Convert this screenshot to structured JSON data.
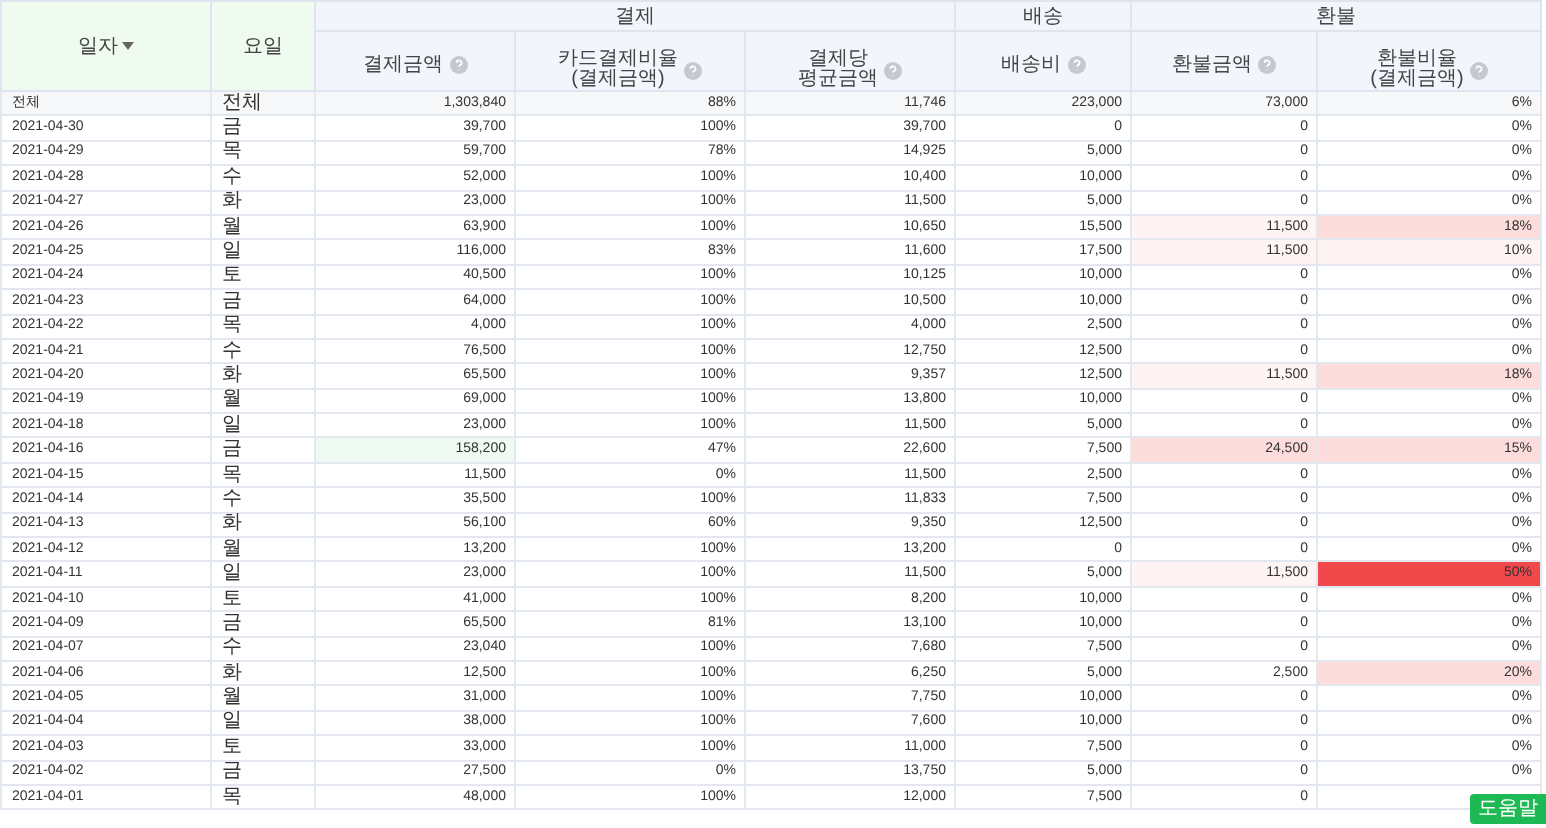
{
  "header": {
    "date": "일자",
    "weekday": "요일",
    "groups": [
      {
        "label": "결제"
      },
      {
        "label": "배송"
      },
      {
        "label": "환불"
      }
    ],
    "columns": [
      {
        "label": "결제금액"
      },
      {
        "label": "카드결제비율",
        "sub": "(결제금액)"
      },
      {
        "label": "결제당",
        "sub": "평균금액"
      },
      {
        "label": "배송비"
      },
      {
        "label": "환불금액"
      },
      {
        "label": "환불비율",
        "sub": "(결제금액)"
      }
    ]
  },
  "total": {
    "date": "전체",
    "day": "전체",
    "cells": [
      {
        "v": "1,303,840"
      },
      {
        "v": "88%"
      },
      {
        "v": "11,746"
      },
      {
        "v": "223,000"
      },
      {
        "v": "73,000"
      },
      {
        "v": "6%"
      }
    ]
  },
  "rows": [
    {
      "date": "2021-04-30",
      "day": "금",
      "cells": [
        {
          "v": "39,700"
        },
        {
          "v": "100%"
        },
        {
          "v": "39,700"
        },
        {
          "v": "0"
        },
        {
          "v": "0"
        },
        {
          "v": "0%"
        }
      ]
    },
    {
      "date": "2021-04-29",
      "day": "목",
      "cells": [
        {
          "v": "59,700"
        },
        {
          "v": "78%"
        },
        {
          "v": "14,925"
        },
        {
          "v": "5,000"
        },
        {
          "v": "0"
        },
        {
          "v": "0%"
        }
      ]
    },
    {
      "date": "2021-04-28",
      "day": "수",
      "cells": [
        {
          "v": "52,000"
        },
        {
          "v": "100%"
        },
        {
          "v": "10,400"
        },
        {
          "v": "10,000"
        },
        {
          "v": "0"
        },
        {
          "v": "0%"
        }
      ]
    },
    {
      "date": "2021-04-27",
      "day": "화",
      "cells": [
        {
          "v": "23,000"
        },
        {
          "v": "100%"
        },
        {
          "v": "11,500"
        },
        {
          "v": "5,000"
        },
        {
          "v": "0"
        },
        {
          "v": "0%"
        }
      ]
    },
    {
      "date": "2021-04-26",
      "day": "월",
      "cells": [
        {
          "v": "63,900"
        },
        {
          "v": "100%"
        },
        {
          "v": "10,650"
        },
        {
          "v": "15,500"
        },
        {
          "v": "11,500",
          "color": "#fff4f4"
        },
        {
          "v": "18%",
          "color": "#fddcdc"
        }
      ]
    },
    {
      "date": "2021-04-25",
      "day": "일",
      "cells": [
        {
          "v": "116,000"
        },
        {
          "v": "83%"
        },
        {
          "v": "11,600"
        },
        {
          "v": "17,500"
        },
        {
          "v": "11,500",
          "color": "#fff4f4"
        },
        {
          "v": "10%",
          "color": "#fff4f4"
        }
      ]
    },
    {
      "date": "2021-04-24",
      "day": "토",
      "cells": [
        {
          "v": "40,500"
        },
        {
          "v": "100%"
        },
        {
          "v": "10,125"
        },
        {
          "v": "10,000"
        },
        {
          "v": "0"
        },
        {
          "v": "0%"
        }
      ]
    },
    {
      "date": "2021-04-23",
      "day": "금",
      "cells": [
        {
          "v": "64,000"
        },
        {
          "v": "100%"
        },
        {
          "v": "10,500"
        },
        {
          "v": "10,000"
        },
        {
          "v": "0"
        },
        {
          "v": "0%"
        }
      ]
    },
    {
      "date": "2021-04-22",
      "day": "목",
      "cells": [
        {
          "v": "4,000"
        },
        {
          "v": "100%"
        },
        {
          "v": "4,000"
        },
        {
          "v": "2,500"
        },
        {
          "v": "0"
        },
        {
          "v": "0%"
        }
      ]
    },
    {
      "date": "2021-04-21",
      "day": "수",
      "cells": [
        {
          "v": "76,500"
        },
        {
          "v": "100%"
        },
        {
          "v": "12,750"
        },
        {
          "v": "12,500"
        },
        {
          "v": "0"
        },
        {
          "v": "0%"
        }
      ]
    },
    {
      "date": "2021-04-20",
      "day": "화",
      "cells": [
        {
          "v": "65,500"
        },
        {
          "v": "100%"
        },
        {
          "v": "9,357"
        },
        {
          "v": "12,500"
        },
        {
          "v": "11,500",
          "color": "#fff4f4"
        },
        {
          "v": "18%",
          "color": "#fddcdc"
        }
      ]
    },
    {
      "date": "2021-04-19",
      "day": "월",
      "cells": [
        {
          "v": "69,000"
        },
        {
          "v": "100%"
        },
        {
          "v": "13,800"
        },
        {
          "v": "10,000"
        },
        {
          "v": "0"
        },
        {
          "v": "0%"
        }
      ]
    },
    {
      "date": "2021-04-18",
      "day": "일",
      "cells": [
        {
          "v": "23,000"
        },
        {
          "v": "100%"
        },
        {
          "v": "11,500"
        },
        {
          "v": "5,000"
        },
        {
          "v": "0"
        },
        {
          "v": "0%"
        }
      ]
    },
    {
      "date": "2021-04-16",
      "day": "금",
      "cells": [
        {
          "v": "158,200",
          "color": "#effaf3"
        },
        {
          "v": "47%"
        },
        {
          "v": "22,600"
        },
        {
          "v": "7,500"
        },
        {
          "v": "24,500",
          "color": "#fddcdc"
        },
        {
          "v": "15%",
          "color": "#fddcdc"
        }
      ]
    },
    {
      "date": "2021-04-15",
      "day": "목",
      "cells": [
        {
          "v": "11,500"
        },
        {
          "v": "0%"
        },
        {
          "v": "11,500"
        },
        {
          "v": "2,500"
        },
        {
          "v": "0"
        },
        {
          "v": "0%"
        }
      ]
    },
    {
      "date": "2021-04-14",
      "day": "수",
      "cells": [
        {
          "v": "35,500"
        },
        {
          "v": "100%"
        },
        {
          "v": "11,833"
        },
        {
          "v": "7,500"
        },
        {
          "v": "0"
        },
        {
          "v": "0%"
        }
      ]
    },
    {
      "date": "2021-04-13",
      "day": "화",
      "cells": [
        {
          "v": "56,100"
        },
        {
          "v": "60%"
        },
        {
          "v": "9,350"
        },
        {
          "v": "12,500"
        },
        {
          "v": "0"
        },
        {
          "v": "0%"
        }
      ]
    },
    {
      "date": "2021-04-12",
      "day": "월",
      "cells": [
        {
          "v": "13,200"
        },
        {
          "v": "100%"
        },
        {
          "v": "13,200"
        },
        {
          "v": "0"
        },
        {
          "v": "0"
        },
        {
          "v": "0%"
        }
      ]
    },
    {
      "date": "2021-04-11",
      "day": "일",
      "cells": [
        {
          "v": "23,000"
        },
        {
          "v": "100%"
        },
        {
          "v": "11,500"
        },
        {
          "v": "5,000"
        },
        {
          "v": "11,500",
          "color": "#fff4f4"
        },
        {
          "v": "50%",
          "color": "#f0484b"
        }
      ]
    },
    {
      "date": "2021-04-10",
      "day": "토",
      "cells": [
        {
          "v": "41,000"
        },
        {
          "v": "100%"
        },
        {
          "v": "8,200"
        },
        {
          "v": "10,000"
        },
        {
          "v": "0"
        },
        {
          "v": "0%"
        }
      ]
    },
    {
      "date": "2021-04-09",
      "day": "금",
      "cells": [
        {
          "v": "65,500"
        },
        {
          "v": "81%"
        },
        {
          "v": "13,100"
        },
        {
          "v": "10,000"
        },
        {
          "v": "0"
        },
        {
          "v": "0%"
        }
      ]
    },
    {
      "date": "2021-04-07",
      "day": "수",
      "cells": [
        {
          "v": "23,040"
        },
        {
          "v": "100%"
        },
        {
          "v": "7,680"
        },
        {
          "v": "7,500"
        },
        {
          "v": "0"
        },
        {
          "v": "0%"
        }
      ]
    },
    {
      "date": "2021-04-06",
      "day": "화",
      "cells": [
        {
          "v": "12,500"
        },
        {
          "v": "100%"
        },
        {
          "v": "6,250"
        },
        {
          "v": "5,000"
        },
        {
          "v": "2,500"
        },
        {
          "v": "20%",
          "color": "#fddcdc"
        }
      ]
    },
    {
      "date": "2021-04-05",
      "day": "월",
      "cells": [
        {
          "v": "31,000"
        },
        {
          "v": "100%"
        },
        {
          "v": "7,750"
        },
        {
          "v": "10,000"
        },
        {
          "v": "0"
        },
        {
          "v": "0%"
        }
      ]
    },
    {
      "date": "2021-04-04",
      "day": "일",
      "cells": [
        {
          "v": "38,000"
        },
        {
          "v": "100%"
        },
        {
          "v": "7,600"
        },
        {
          "v": "10,000"
        },
        {
          "v": "0"
        },
        {
          "v": "0%"
        }
      ]
    },
    {
      "date": "2021-04-03",
      "day": "토",
      "cells": [
        {
          "v": "33,000"
        },
        {
          "v": "100%"
        },
        {
          "v": "11,000"
        },
        {
          "v": "7,500"
        },
        {
          "v": "0"
        },
        {
          "v": "0%"
        }
      ]
    },
    {
      "date": "2021-04-02",
      "day": "금",
      "cells": [
        {
          "v": "27,500"
        },
        {
          "v": "0%"
        },
        {
          "v": "13,750"
        },
        {
          "v": "5,000"
        },
        {
          "v": "0"
        },
        {
          "v": "0%"
        }
      ]
    },
    {
      "date": "2021-04-01",
      "day": "목",
      "cells": [
        {
          "v": "48,000"
        },
        {
          "v": "100%"
        },
        {
          "v": "12,000"
        },
        {
          "v": "7,500"
        },
        {
          "v": "0"
        }
      ]
    }
  ],
  "help_button": "도움말"
}
